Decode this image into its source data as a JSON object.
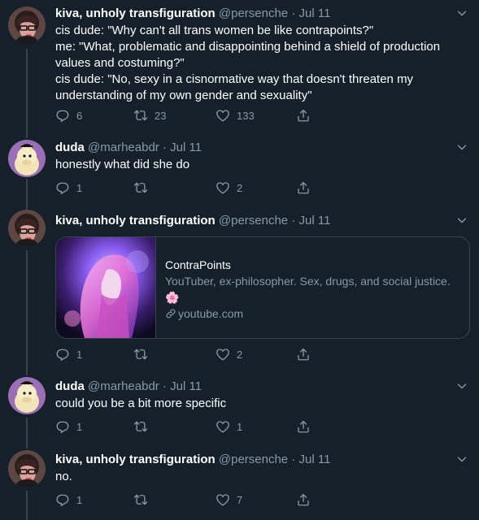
{
  "tweets": [
    {
      "name": "kiva, unholy transfiguration",
      "handle": "@persenche",
      "sep": " · ",
      "date": "Jul 11",
      "text": "cis dude: \"Why can't all trans women be like contrapoints?\"\nme: \"What, problematic and disappointing behind a shield of production values and costuming?\"\ncis dude: \"No, sexy in a cisnormative way that doesn't threaten my understanding of my own gender and sexuality\"",
      "replies": "6",
      "retweets": "23",
      "likes": "133"
    },
    {
      "name": "duda",
      "handle": "@marheabdr",
      "sep": " · ",
      "date": "Jul 11",
      "text": "honestly what did she do",
      "replies": "1",
      "retweets": "",
      "likes": "2"
    },
    {
      "name": "kiva, unholy transfiguration",
      "handle": "@persenche",
      "sep": " · ",
      "date": "Jul 11",
      "text": "",
      "replies": "1",
      "retweets": "",
      "likes": "2",
      "card": {
        "title": "ContraPoints",
        "description": "YouTuber, ex-philosopher. Sex, drugs, and social justice. 🌸",
        "link": "youtube.com"
      }
    },
    {
      "name": "duda",
      "handle": "@marheabdr",
      "sep": " · ",
      "date": "Jul 11",
      "text": "could you be a bit more specific",
      "replies": "1",
      "retweets": "",
      "likes": "1"
    },
    {
      "name": "kiva, unholy transfiguration",
      "handle": "@persenche",
      "sep": " · ",
      "date": "Jul 11",
      "text": "no.",
      "replies": "1",
      "retweets": "",
      "likes": "7"
    }
  ],
  "icons": {
    "reply": "reply-icon",
    "retweet": "retweet-icon",
    "like": "heart-icon",
    "share": "share-icon",
    "caret": "chevron-down-icon",
    "link": "link-icon"
  },
  "colors": {
    "background": "#15202b",
    "border": "#38444d",
    "secondary_text": "#8899a6",
    "primary_text": "#ffffff"
  }
}
